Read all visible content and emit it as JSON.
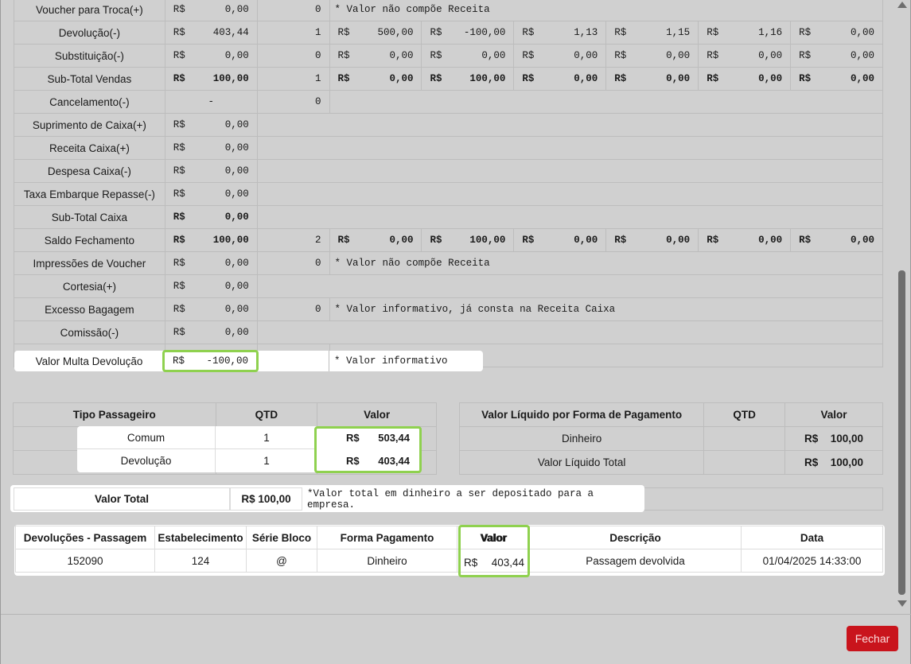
{
  "currency": "R$",
  "summary_rows": [
    {
      "label": "Voucher para Troca(+)",
      "total": "0,00",
      "qtd": "0",
      "note": "* Valor não compõe Receita"
    },
    {
      "label": "Devolução(-)",
      "total": "403,44",
      "qtd": "1",
      "subs": [
        "500,00",
        "-100,00",
        "1,13",
        "1,15",
        "1,16",
        "0,00"
      ]
    },
    {
      "label": "Substituição(-)",
      "total": "0,00",
      "qtd": "0",
      "subs": [
        "0,00",
        "0,00",
        "0,00",
        "0,00",
        "0,00",
        "0,00"
      ]
    },
    {
      "label": "Sub-Total Vendas",
      "total": "100,00",
      "qtd": "1",
      "subs": [
        "0,00",
        "100,00",
        "0,00",
        "0,00",
        "0,00",
        "0,00"
      ]
    },
    {
      "label": "Cancelamento(-)",
      "total": "-",
      "qtd": "0"
    },
    {
      "label": "Suprimento de Caixa(+)",
      "total": "0,00"
    },
    {
      "label": "Receita Caixa(+)",
      "total": "0,00"
    },
    {
      "label": "Despesa Caixa(-)",
      "total": "0,00"
    },
    {
      "label": "Taxa Embarque Repasse(-)",
      "total": "0,00"
    },
    {
      "label": "Sub-Total Caixa",
      "total": "0,00"
    },
    {
      "label": "Saldo Fechamento",
      "total": "100,00",
      "qtd": "2",
      "subs": [
        "0,00",
        "100,00",
        "0,00",
        "0,00",
        "0,00",
        "0,00"
      ]
    },
    {
      "label": "Impressões de Voucher",
      "total": "0,00",
      "qtd": "0",
      "note": "* Valor não compõe Receita"
    },
    {
      "label": "Cortesia(+)",
      "total": "0,00"
    },
    {
      "label": "Excesso Bagagem",
      "total": "0,00",
      "qtd": "0",
      "note": "* Valor informativo, já consta na Receita Caixa"
    },
    {
      "label": "Comissão(-)",
      "total": "0,00"
    },
    {
      "label": "Valor Multa Devolução",
      "total": "-100,00",
      "note": "* Valor informativo"
    }
  ],
  "passenger": {
    "headers": [
      "Tipo Passageiro",
      "QTD",
      "Valor"
    ],
    "rows": [
      {
        "tipo": "Comum",
        "qtd": "1",
        "valor": "503,44"
      },
      {
        "tipo": "Devolução",
        "qtd": "1",
        "valor": "403,44"
      }
    ]
  },
  "payment": {
    "headers": [
      "Valor Líquido por Forma de Pagamento",
      "QTD",
      "Valor"
    ],
    "rows": [
      {
        "forma": "Dinheiro",
        "qtd": "",
        "valor": "100,00"
      },
      {
        "forma": "Valor Líquido Total",
        "qtd": "",
        "valor": "100,00"
      }
    ]
  },
  "valor_total": {
    "label": "Valor Total",
    "value": "R$ 100,00",
    "note": "*Valor total em dinheiro a ser depositado para a empresa."
  },
  "devolucoes": {
    "headers": [
      "Devoluções - Passagem",
      "Estabelecimento",
      "Série Bloco",
      "Forma Pagamento",
      "Valor",
      "Descrição",
      "Data"
    ],
    "row": {
      "passagem": "152090",
      "estabelecimento": "124",
      "serie": "@",
      "forma": "Dinheiro",
      "valor": "403,44",
      "descricao": "Passagem devolvida",
      "data": "01/04/2025 14:33:00"
    }
  },
  "buttons": {
    "fechar": "Fechar"
  },
  "colors": {
    "highlight_green": "#8fd14f",
    "button_red": "#c9141c"
  }
}
